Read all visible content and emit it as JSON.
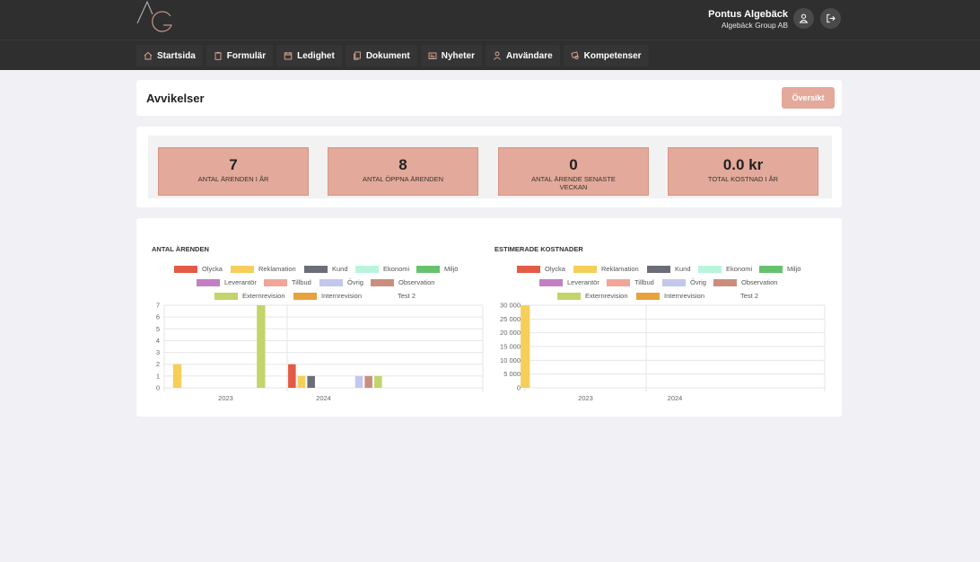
{
  "user": {
    "name": "Pontus Algebäck",
    "company": "Algebäck Group AB"
  },
  "header_icons": [
    "user-icon",
    "logout-icon"
  ],
  "nav": [
    {
      "label": "Startsida",
      "icon": "home-icon"
    },
    {
      "label": "Formulär",
      "icon": "clipboard-icon"
    },
    {
      "label": "Ledighet",
      "icon": "calendar-icon"
    },
    {
      "label": "Dokument",
      "icon": "documents-icon"
    },
    {
      "label": "Nyheter",
      "icon": "newspaper-icon"
    },
    {
      "label": "Användare",
      "icon": "user-icon"
    },
    {
      "label": "Kompetenser",
      "icon": "certificate-icon"
    }
  ],
  "page": {
    "title": "Avvikelser",
    "overview_button": "Översikt"
  },
  "stats": [
    {
      "value": "7",
      "label": "ANTAL ÄRENDEN I ÅR"
    },
    {
      "value": "8",
      "label": "ANTAL ÖPPNA ÄRENDEN"
    },
    {
      "value": "0",
      "label": "ANTAL ÄRENDE SENASTE VECKAN"
    },
    {
      "value": "0.0 kr",
      "label": "TOTAL KOSTNAD I ÅR"
    }
  ],
  "colors": {
    "accent": "#e3a99a",
    "topbar": "#2f2f2f",
    "series": {
      "Olycka": "#e35a45",
      "Reklamation": "#f5cf5a",
      "Kund": "#6b6d78",
      "Ekonomi": "#b8f5dc",
      "Miljö": "#66c26e",
      "Leverantör": "#c27fc4",
      "Tillbud": "#f0a598",
      "Övrig": "#c3c7ec",
      "Observation": "#c98e7d",
      "Externrevision": "#c2d46a",
      "Internrevision": "#e8a23c",
      "Test 2": "#ffffff"
    }
  },
  "chart_data": [
    {
      "type": "bar",
      "title": "ANTAL ÄRENDEN",
      "categories": [
        "2023",
        "2024"
      ],
      "ylim": [
        0,
        7
      ],
      "yticks": [
        "0",
        "1",
        "2",
        "3",
        "4",
        "5",
        "6",
        "7"
      ],
      "grid": true,
      "legend": "top",
      "series": [
        {
          "name": "Olycka",
          "values": [
            0,
            2
          ]
        },
        {
          "name": "Reklamation",
          "values": [
            2,
            1
          ]
        },
        {
          "name": "Kund",
          "values": [
            0,
            1
          ]
        },
        {
          "name": "Ekonomi",
          "values": [
            0,
            0
          ]
        },
        {
          "name": "Miljö",
          "values": [
            0,
            0
          ]
        },
        {
          "name": "Leverantör",
          "values": [
            0,
            0
          ]
        },
        {
          "name": "Tillbud",
          "values": [
            0,
            0
          ]
        },
        {
          "name": "Övrig",
          "values": [
            0,
            1
          ]
        },
        {
          "name": "Observation",
          "values": [
            0,
            1
          ]
        },
        {
          "name": "Externrevision",
          "values": [
            7,
            1
          ]
        },
        {
          "name": "Internrevision",
          "values": [
            0,
            0
          ]
        },
        {
          "name": "Test 2",
          "values": [
            0,
            0
          ]
        }
      ]
    },
    {
      "type": "bar",
      "title": "ESTIMERADE KOSTNADER",
      "categories": [
        "2023",
        "2024"
      ],
      "ylim": [
        0,
        30000
      ],
      "yticks": [
        "0",
        "5 000",
        "10 000",
        "15 000",
        "20 000",
        "25 000",
        "30 000"
      ],
      "grid": true,
      "legend": "top",
      "series": [
        {
          "name": "Olycka",
          "values": [
            0,
            0
          ]
        },
        {
          "name": "Reklamation",
          "values": [
            30000,
            0
          ]
        },
        {
          "name": "Kund",
          "values": [
            0,
            0
          ]
        },
        {
          "name": "Ekonomi",
          "values": [
            0,
            0
          ]
        },
        {
          "name": "Miljö",
          "values": [
            0,
            0
          ]
        },
        {
          "name": "Leverantör",
          "values": [
            0,
            0
          ]
        },
        {
          "name": "Tillbud",
          "values": [
            0,
            0
          ]
        },
        {
          "name": "Övrig",
          "values": [
            0,
            0
          ]
        },
        {
          "name": "Observation",
          "values": [
            0,
            0
          ]
        },
        {
          "name": "Externrevision",
          "values": [
            0,
            0
          ]
        },
        {
          "name": "Internrevision",
          "values": [
            0,
            0
          ]
        },
        {
          "name": "Test 2",
          "values": [
            0,
            0
          ]
        }
      ]
    }
  ]
}
